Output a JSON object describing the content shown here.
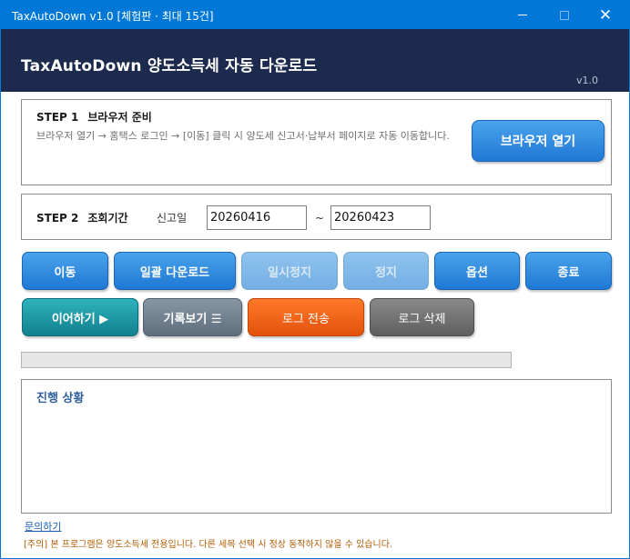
{
  "window": {
    "title": "TaxAutoDown v1.0  [체험판 · 최대 15건]",
    "accent": "#0078d7"
  },
  "header": {
    "app_title": "TaxAutoDown  양도소득세 자동 다운로드",
    "version": "v1.0",
    "bg": "#1c2b4d"
  },
  "step1": {
    "title_step": "STEP 1",
    "title_text": "브라우저 준비",
    "description": "브라우저 열기 → 홈택스 로그인 → [이동] 클릭 시 양도세 신고서·납부서 페이지로 자동 이동합니다.",
    "open_browser_label": "브라우저 열기"
  },
  "step2": {
    "title_step": "STEP 2",
    "title_text": "조회기간",
    "date_label": "신고일",
    "date_from": "20260416",
    "date_separator": "~",
    "date_to": "20260423"
  },
  "actions_row1": {
    "move": "이동",
    "bulk_download": "일괄 다운로드",
    "pause": "일시정지",
    "stop": "정지",
    "options": "옵션",
    "exit": "종료"
  },
  "actions_row2": {
    "resume": "이어하기 ▶",
    "history": "기록보기 ☰",
    "log_send": "로그 전송",
    "log_delete": "로그 삭제"
  },
  "progress": {
    "value": 0
  },
  "status": {
    "title": "진행 상황"
  },
  "footer": {
    "contact": "문의하기",
    "notice": "[주의] 본 프로그램은 양도소득세 전용입니다. 다른 세목 선택 시 정상 동작하지 않을 수 있습니다."
  }
}
